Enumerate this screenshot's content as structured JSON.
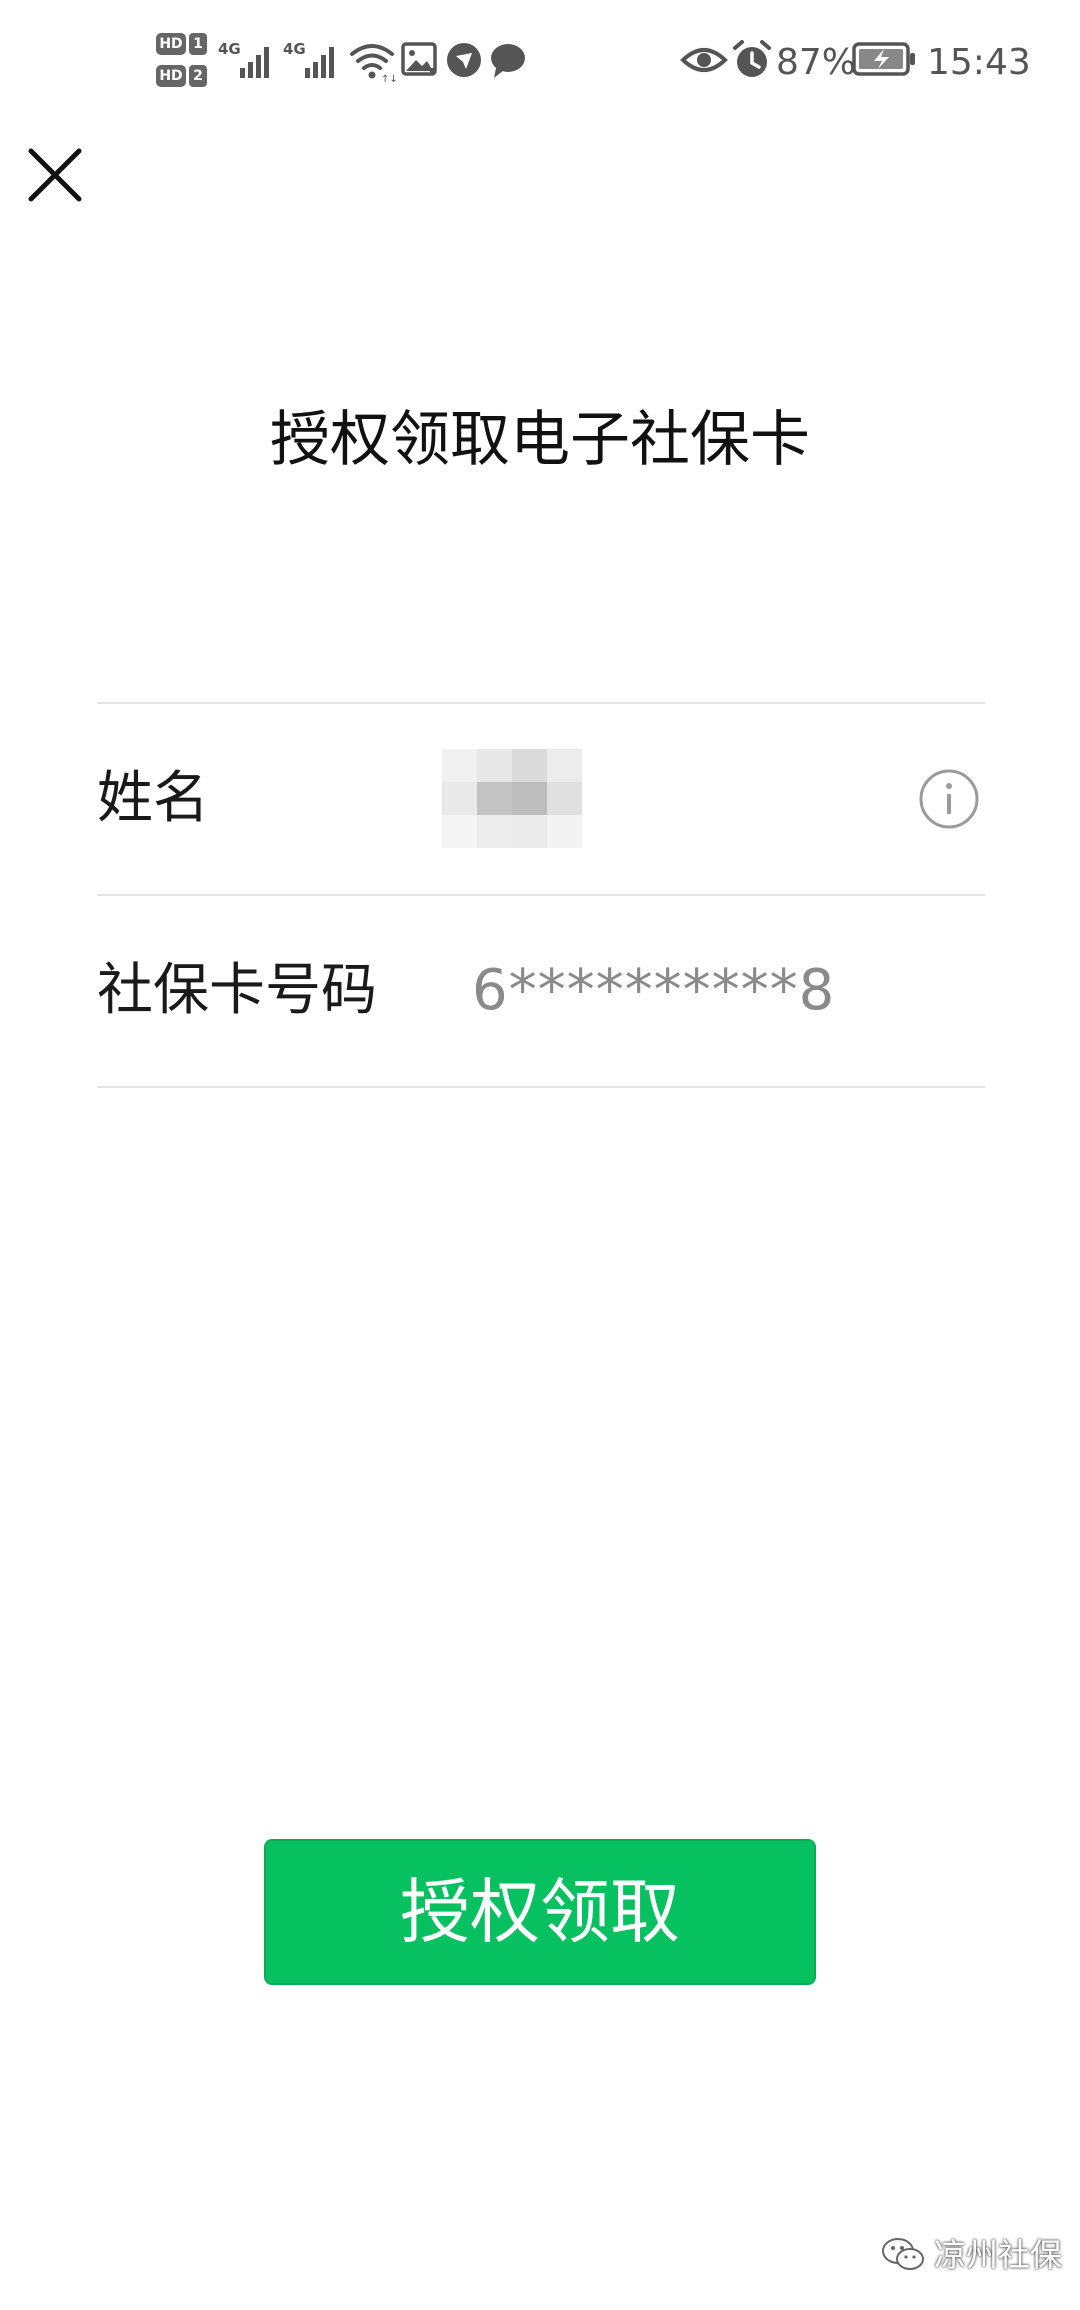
{
  "status_bar": {
    "sim1_label": "HD",
    "sim1_number": "1",
    "sim2_label": "HD",
    "sim2_number": "2",
    "network_1": "4G",
    "network_2": "4G",
    "battery_percent": "87%",
    "time": "15:43",
    "icons": [
      "signal-icon",
      "wifi-icon",
      "gallery-icon",
      "app-notification-icon",
      "message-icon",
      "eye-comfort-icon",
      "alarm-icon",
      "battery-charging-icon"
    ]
  },
  "header": {
    "close_icon": "close-icon",
    "title": "授权领取电子社保卡"
  },
  "form": {
    "name_label": "姓名",
    "name_value": "",
    "info_icon": "info-icon",
    "card_label": "社保卡号码",
    "card_value": "6**********8"
  },
  "action": {
    "claim_label": "授权领取"
  },
  "watermark": {
    "text": "凉州社保",
    "icon": "wechat-icon"
  },
  "colors": {
    "accent": "#07c160",
    "text_primary": "#111111",
    "text_secondary": "#8a8a8a",
    "divider": "#e4e4e4"
  }
}
